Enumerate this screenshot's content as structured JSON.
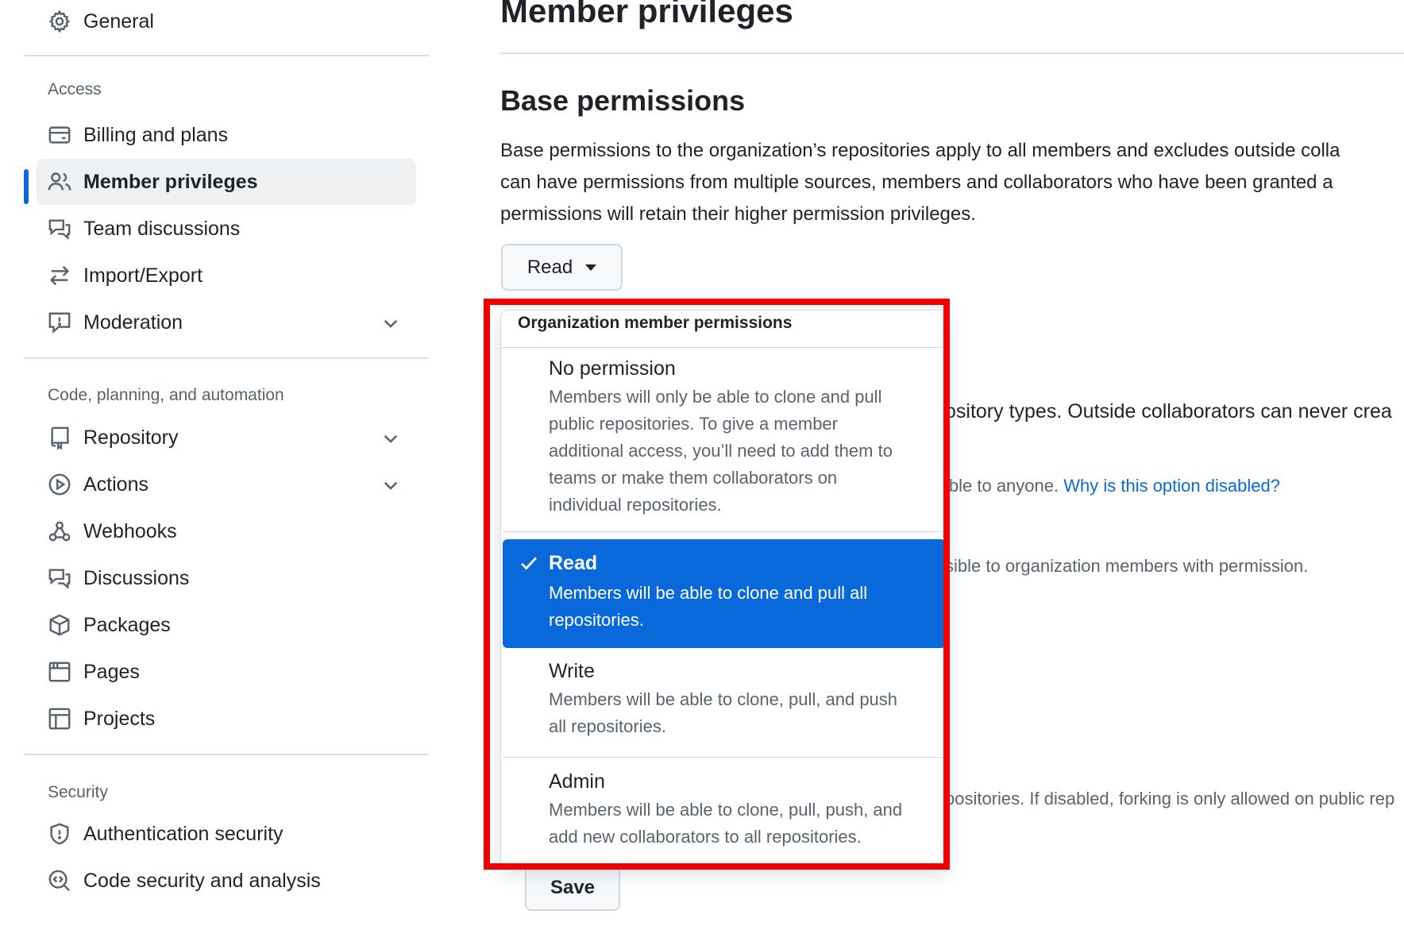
{
  "sidebar": {
    "general_label": "General",
    "sections": {
      "access": "Access",
      "code": "Code, planning, and automation",
      "security": "Security"
    },
    "items": {
      "billing": "Billing and plans",
      "member_privileges": "Member privileges",
      "team_discussions": "Team discussions",
      "import_export": "Import/Export",
      "moderation": "Moderation",
      "repository": "Repository",
      "actions": "Actions",
      "webhooks": "Webhooks",
      "discussions": "Discussions",
      "packages": "Packages",
      "pages": "Pages",
      "projects": "Projects",
      "auth_security": "Authentication security",
      "code_security": "Code security and analysis"
    }
  },
  "main": {
    "title": "Member privileges",
    "base_heading": "Base permissions",
    "description_lines": [
      "Base permissions to the organization’s repositories apply to all members and excludes outside colla",
      "can have permissions from multiple sources, members and collaborators who have been granted a",
      "permissions will retain their higher permission privileges."
    ],
    "base_button_label": "Read",
    "save_label": "Save",
    "bg_text_1": "ository types. Outside collaborators can never crea",
    "bg_text_2": "ible to anyone. ",
    "bg_link": "Why is this option disabled?",
    "bg_text_3": "sible to organization members with permission.",
    "bg_text_4": "positories. If disabled, forking is only allowed on public rep"
  },
  "menu": {
    "header": "Organization member permissions",
    "options": [
      {
        "title": "No permission",
        "desc_lines": [
          "Members will only be able to clone and pull",
          "public repositories. To give a member",
          "additional access, you’ll need to add them to",
          "teams or make them collaborators on",
          "individual repositories."
        ],
        "selected": false
      },
      {
        "title": "Read",
        "desc_lines": [
          "Members will be able to clone and pull all",
          "repositories."
        ],
        "selected": true
      },
      {
        "title": "Write",
        "desc_lines": [
          "Members will be able to clone, pull, and push",
          "all repositories."
        ],
        "selected": false
      },
      {
        "title": "Admin",
        "desc_lines": [
          "Members will be able to clone, pull, push, and",
          "add new collaborators to all repositories."
        ],
        "selected": false
      }
    ]
  },
  "colors": {
    "accent": "#0969da",
    "highlight_border": "#f00000",
    "text_primary": "#1f2328",
    "text_muted": "#59636e"
  },
  "icons": [
    "gear-icon",
    "credit-card-icon",
    "people-icon",
    "comment-discussion-icon",
    "arrow-switch-icon",
    "report-icon",
    "repo-icon",
    "play-icon",
    "webhook-icon",
    "package-icon",
    "browser-icon",
    "table-icon",
    "shield-icon",
    "codescan-icon",
    "chevron-down-icon",
    "check-icon",
    "triangle-down-icon"
  ]
}
